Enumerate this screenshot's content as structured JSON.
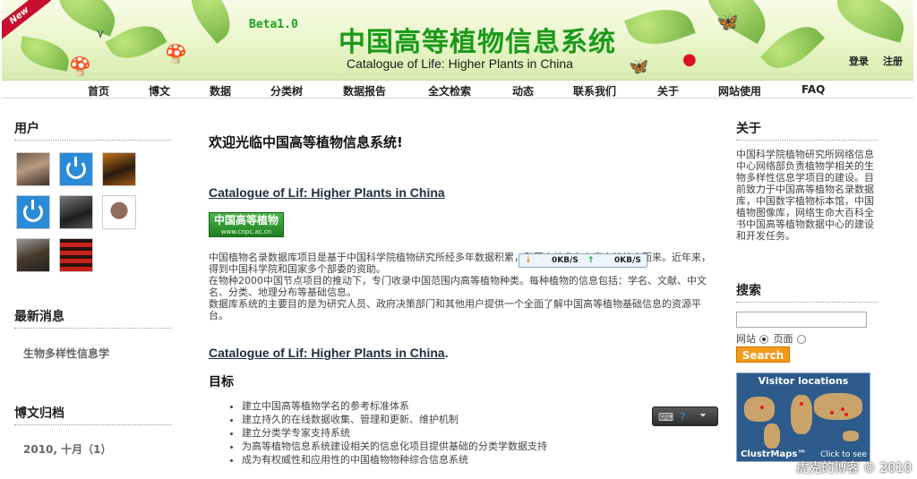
{
  "banner": {
    "ribbon": "New",
    "beta": "Beta1.0",
    "title": "中国高等植物信息系统",
    "subtitle": "Catalogue of Life: Higher Plants in China",
    "login": "登录",
    "register": "注册"
  },
  "nav": [
    "首页",
    "博文",
    "数据",
    "分类树",
    "数据报告",
    "全文检索",
    "动态",
    "联系我们",
    "关于",
    "网站使用",
    "FAQ"
  ],
  "left": {
    "users_heading": "用户",
    "news_heading": "最新消息",
    "news_item": "生物多样性信息学",
    "archive_heading": "博文归档",
    "archive_item": "2010, 十月（1）"
  },
  "main": {
    "welcome": "欢迎光临中国高等植物信息系统!",
    "section1_link": "Catalogue of Lif: Higher Plants in China",
    "badge_title": "中国高等植物",
    "badge_url": "www.cnpc.ac.cn",
    "para1": "中国植物名录数据库项目是基于中国科学院植物研究所经多年数据积累，和国内外多名专家审核补充而来。近年来，得到中国科学院和国家多个部委的资助。",
    "para2": "在物种2000中国节点项目的推动下，专门收录中国范围内高等植物种类。每种植物的信息包括：学名、文献、中文名、分类、地理分布等基础信息。",
    "para3": "数据库系统的主要目的是为研究人员、政府决策部门和其他用户提供一个全面了解中国高等植物基础信息的资源平台。",
    "section2_link": "Catalogue of Lif: Higher Plants in China",
    "section2_dot": ".",
    "goal_heading": "目标",
    "goals": [
      "建立中国高等植物学名的参考标准体系",
      "建立持久的在线数据收集、管理和更新、维护机制",
      "建立分类学专家支持系统",
      "为高等植物信息系统建设相关的信息化项目提供基础的分类学数据支持",
      "成为有权威性和应用性的中国植物物种综合信息系统"
    ]
  },
  "speed_widget": {
    "down": "0KB/S",
    "up": "0KB/S"
  },
  "right": {
    "about_heading": "关于",
    "about_text": "中国科学院植物研究所网络信息中心网络部负责植物学相关的生物多样性信息学项目的建设。目前致力于中国高等植物名录数据库，中国数字植物标本馆，中国植物图像库，网络生命大百科全书中国高等植物数据中心的建设和开发任务。",
    "search_heading": "搜索",
    "search_value": "",
    "radio_site": "网站",
    "radio_page": "页面",
    "search_button": "Search",
    "map_title": "Visitor locations",
    "map_brand": "ClustrMaps™",
    "map_cta": "Click to see"
  },
  "watermark": "虎克的博客 © 2010"
}
